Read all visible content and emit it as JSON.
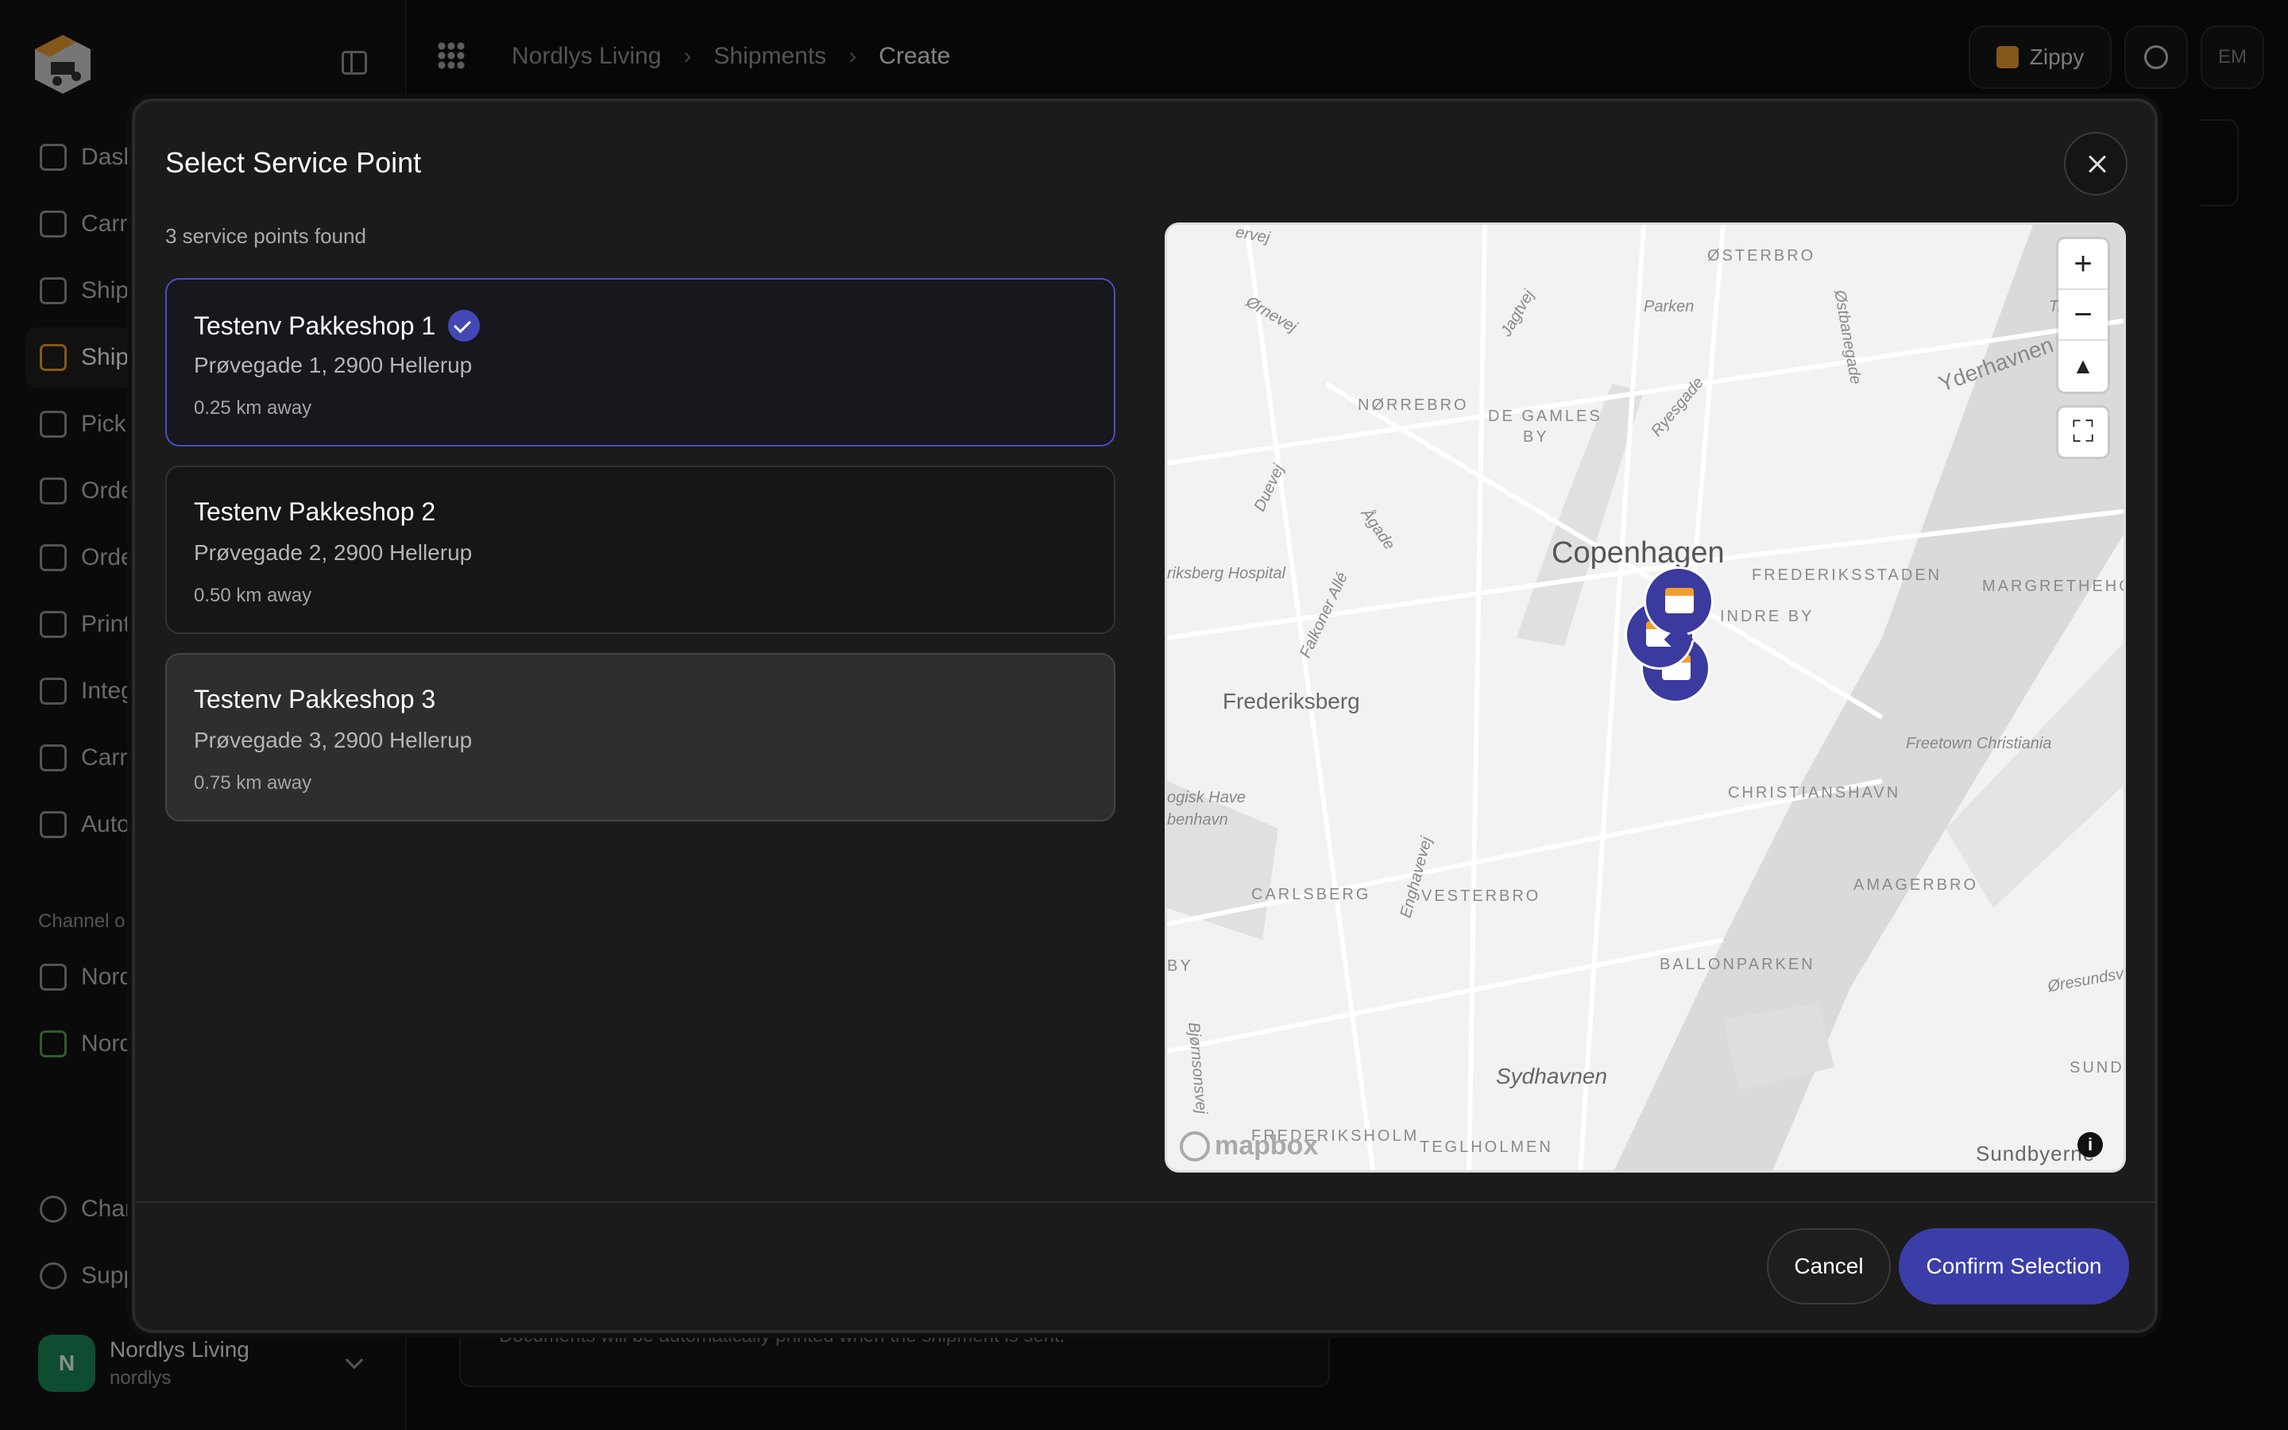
{
  "breadcrumb": {
    "items": [
      "Nordlys Living",
      "Shipments",
      "Create"
    ]
  },
  "topbar": {
    "carrier_label": "Zippy",
    "user_initials": "EM"
  },
  "sidebar": {
    "items": [
      {
        "label": "Dash",
        "icon": "dashboard-icon"
      },
      {
        "label": "Carri",
        "icon": "truck-icon"
      },
      {
        "label": "Shipp",
        "icon": "sliders-icon"
      },
      {
        "label": "Shipm",
        "icon": "boxes-icon"
      },
      {
        "label": "Picku",
        "icon": "calendar-icon"
      },
      {
        "label": "Orde",
        "icon": "clipboard-icon"
      },
      {
        "label": "Orde",
        "icon": "cart-icon"
      },
      {
        "label": "Print",
        "icon": "printer-icon"
      },
      {
        "label": "Integ",
        "icon": "puzzle-icon"
      },
      {
        "label": "Carri",
        "icon": "route-icon"
      },
      {
        "label": "Auto",
        "icon": "bolt-icon"
      }
    ],
    "section_label": "Channel o",
    "channels": [
      {
        "label": "Nord",
        "icon": "webhook-icon"
      },
      {
        "label": "Nord",
        "icon": "shopify-icon"
      }
    ],
    "bottom_items": [
      {
        "label": "Char",
        "icon": "history-icon"
      },
      {
        "label": "Supp",
        "icon": "help-icon"
      }
    ],
    "org": {
      "initial": "N",
      "name": "Nordlys Living",
      "handle": "nordlys"
    }
  },
  "background": {
    "notice": "Documents will be automatically printed when the shipment is sent."
  },
  "modal": {
    "title": "Select Service Point",
    "count_text": "3 service points found",
    "cancel_label": "Cancel",
    "confirm_label": "Confirm Selection",
    "service_points": [
      {
        "name": "Testenv Pakkeshop 1",
        "address": "Prøvegade 1, 2900 Hellerup",
        "distance": "0.25 km away",
        "selected": true
      },
      {
        "name": "Testenv Pakkeshop 2",
        "address": "Prøvegade 2, 2900 Hellerup",
        "distance": "0.50 km away",
        "selected": false
      },
      {
        "name": "Testenv Pakkeshop 3",
        "address": "Prøvegade 3, 2900 Hellerup",
        "distance": "0.75 km away",
        "selected": false
      }
    ]
  },
  "map": {
    "attribution": "mapbox",
    "labels": {
      "copenhagen": "Copenhagen",
      "frederiksberg": "Frederiksberg",
      "sydhavnen": "Sydhavnen",
      "osterbro": "ØSTERBRO",
      "norrebro": "NØRREBRO",
      "degamles": "DE GAMLES",
      "by": "BY",
      "parken": "Parken",
      "frederiksstaden": "FREDERIKSSTADEN",
      "indreby": "INDRE BY",
      "christianshavn": "CHRISTIANSHAVN",
      "amagerbro": "AMAGERBRO",
      "vesterbro": "VESTERBRO",
      "carlsberg": "CARLSBERG",
      "ballonparken": "BALLONPARKEN",
      "frederiksholm": "FREDERIKSHOLM",
      "teglholmen": "TEGLHOLMEN",
      "margretheholm": "MARGRETHEHOLM",
      "christiania": "Freetown Christiania",
      "hospital": "riksberg Hospital",
      "botanisk1": "ogisk Have",
      "botanisk2": "benhavn",
      "sundbyerne": "Sundbyerne",
      "yderhavnen": "Yderhavnen",
      "orsundsvej": "Øresundsv",
      "sund": "SUND",
      "jagtvej": "Jagtvej",
      "ornevej": "Ørnevej",
      "ryesgade": "Ryesgade",
      "osbanegade": "Østbanegade",
      "duevej": "Duevej",
      "aagade": "Ågade",
      "falkoner": "Falkoner Allé",
      "enghavevej": "Enghavevej",
      "bjornson": "Bjørnsonsvej",
      "trek": "Trek",
      "ervej": "ervej",
      "by2": "BY"
    }
  }
}
